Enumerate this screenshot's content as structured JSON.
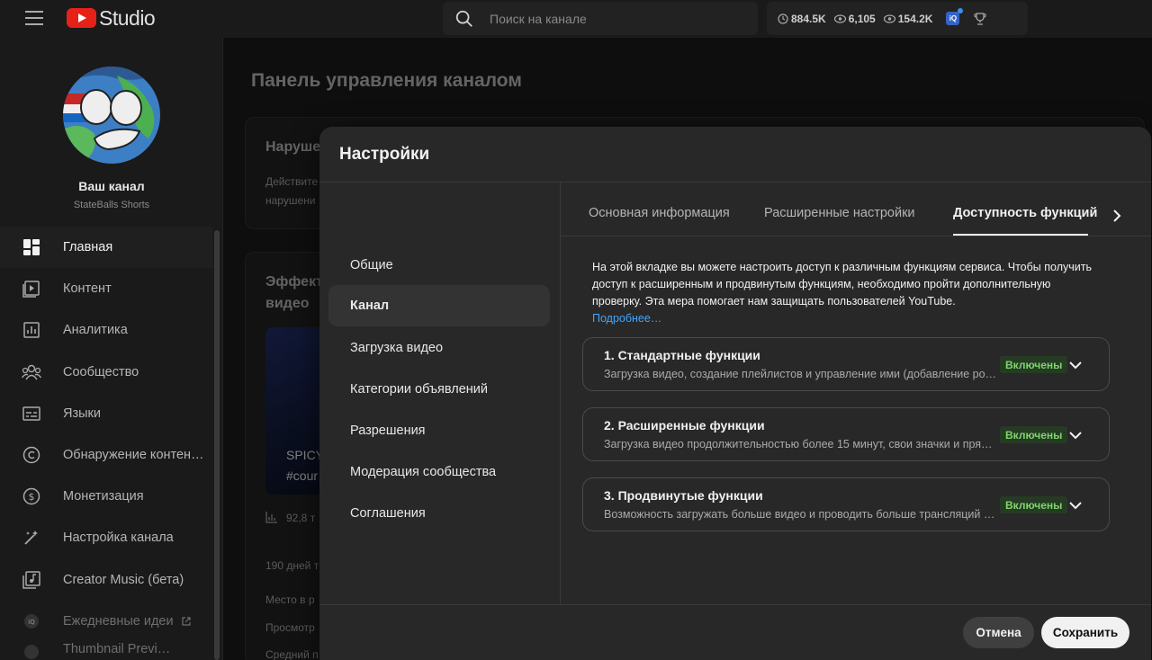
{
  "app": {
    "logo_text": "Studio"
  },
  "search": {
    "placeholder": "Поиск на канале"
  },
  "stats": {
    "watch_hours": "884.5K",
    "views_live": "6,105",
    "views_total": "154.2K"
  },
  "channel": {
    "name": "Ваш канал",
    "handle": "StateBalls Shorts"
  },
  "sidebar": {
    "items": [
      {
        "label": "Главная",
        "icon": "dashboard-icon",
        "active": true
      },
      {
        "label": "Контент",
        "icon": "content-icon"
      },
      {
        "label": "Аналитика",
        "icon": "analytics-icon"
      },
      {
        "label": "Сообщество",
        "icon": "community-icon"
      },
      {
        "label": "Языки",
        "icon": "subtitles-icon"
      },
      {
        "label": "Обнаружение контен…",
        "icon": "copyright-icon"
      },
      {
        "label": "Монетизация",
        "icon": "monetization-icon"
      },
      {
        "label": "Настройка канала",
        "icon": "magic-wand-icon"
      },
      {
        "label": "Creator Music (бета)",
        "icon": "music-icon"
      },
      {
        "label": "Ежедневные идеи",
        "icon": "ideas-icon"
      },
      {
        "label": "Thumbnail Previ…",
        "icon": "thumbnail-icon"
      }
    ]
  },
  "background": {
    "page_title": "Панель управления каналом",
    "card1_title": "Наруше",
    "card1_line1": "Действите",
    "card1_line2": "нарушени",
    "card2_title_1": "Эффект",
    "card2_title_2": "видео",
    "thumb_line1": "SPICY",
    "thumb_line2": "#cour",
    "views_stat": "92,8 т",
    "days_text": "190 дней т",
    "row1": "Место в р",
    "row2": "Просмотр",
    "row3": "Средний п"
  },
  "modal": {
    "title": "Настройки",
    "nav": [
      {
        "label": "Общие"
      },
      {
        "label": "Канал",
        "active": true
      },
      {
        "label": "Загрузка видео"
      },
      {
        "label": "Категории объявлений"
      },
      {
        "label": "Разрешения"
      },
      {
        "label": "Модерация сообщества"
      },
      {
        "label": "Соглашения"
      }
    ],
    "tabs": [
      {
        "label": "Основная информация"
      },
      {
        "label": "Расширенные настройки"
      },
      {
        "label": "Доступность функций",
        "active": true
      }
    ],
    "description": "На этой вкладке вы можете настроить доступ к различным функциям сервиса. Чтобы получить доступ к расширенным и продвинутым функциям, необходимо пройти дополнительную проверку. Эта мера помогает нам защищать пользователей YouTube.",
    "more_link": "Подробнее…",
    "features": [
      {
        "title": "1. Стандартные функции",
        "desc": "Загрузка видео, создание плейлистов и управление ими (добавление ро…",
        "status": "Включены"
      },
      {
        "title": "2. Расширенные функции",
        "desc": "Загрузка видео продолжительностью более 15 минут, свои значки и пря…",
        "status": "Включены"
      },
      {
        "title": "3. Продвинутые функции",
        "desc": "Возможность загружать больше видео и проводить больше трансляций …",
        "status": "Включены"
      }
    ],
    "cancel_label": "Отмена",
    "save_label": "Сохранить"
  },
  "colors": {
    "accent_blue": "#3ea6ff",
    "enabled_badge_text": "#7ed66b",
    "logo_red": "#e62117"
  }
}
